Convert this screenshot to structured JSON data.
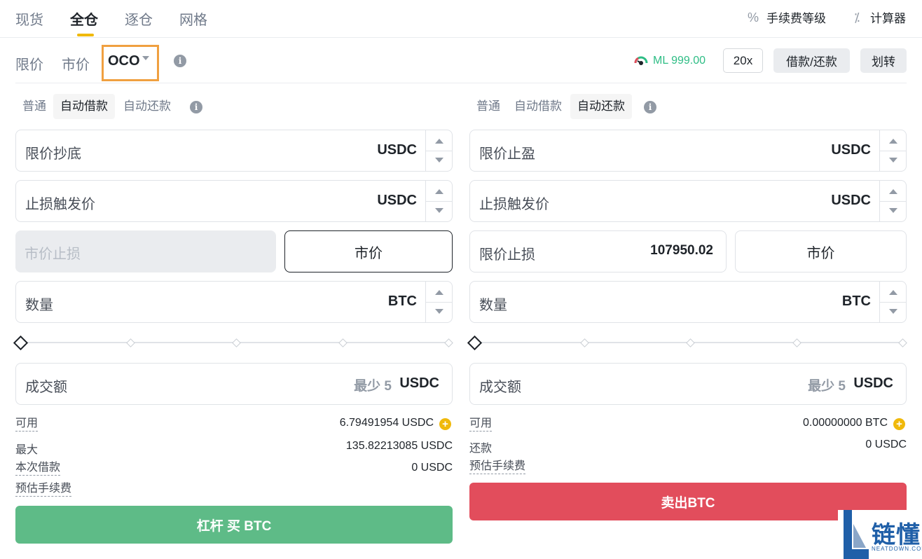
{
  "top_tabs": [
    "现货",
    "全仓",
    "逐仓",
    "网格"
  ],
  "top_right": {
    "fee_level": "手续费等级",
    "calculator": "计算器"
  },
  "order_types": {
    "limit": "限价",
    "market": "市价",
    "oco": "OCO"
  },
  "margin_level": "ML 999.00",
  "leverage": "20x",
  "borrow_repay": "借款/还款",
  "transfer": "划转",
  "buy": {
    "modes": [
      "普通",
      "自动借款",
      "自动还款"
    ],
    "active_mode": "自动借款",
    "limit_label": "限价抄底",
    "limit_unit": "USDC",
    "stop_trigger_label": "止损触发价",
    "stop_trigger_unit": "USDC",
    "stop_market_label": "市价止损",
    "market_button": "市价",
    "qty_label": "数量",
    "qty_unit": "BTC",
    "total_label": "成交额",
    "total_min": "最少 5",
    "total_unit": "USDC",
    "available_label": "可用",
    "available_value": "6.79491954 USDC",
    "max_label": "最大",
    "max_value": "135.82213085 USDC",
    "borrow_label": "本次借款",
    "borrow_value": "0 USDC",
    "fee_label": "预估手续费",
    "submit": "杠杆 买 BTC"
  },
  "sell": {
    "modes": [
      "普通",
      "自动借款",
      "自动还款"
    ],
    "active_mode": "自动还款",
    "take_profit_label": "限价止盈",
    "take_profit_unit": "USDC",
    "stop_trigger_label": "止损触发价",
    "stop_trigger_unit": "USDC",
    "stop_limit_label": "限价止损",
    "stop_limit_value": "107950.02",
    "market_button": "市价",
    "qty_label": "数量",
    "qty_unit": "BTC",
    "total_label": "成交额",
    "total_min": "最少 5",
    "total_unit": "USDC",
    "available_label": "可用",
    "available_value": "0.00000000 BTC",
    "repay_label": "还款",
    "repay_value": "0 USDC",
    "fee_label": "预估手续费",
    "submit": "卖出BTC"
  },
  "watermark": {
    "text": "链懂",
    "sub": "NEATDOWN.COM"
  },
  "colors": {
    "accent": "#f0b90b",
    "buy": "#5ebb87",
    "sell": "#e24d5c",
    "oco_highlight": "#f0a040"
  }
}
